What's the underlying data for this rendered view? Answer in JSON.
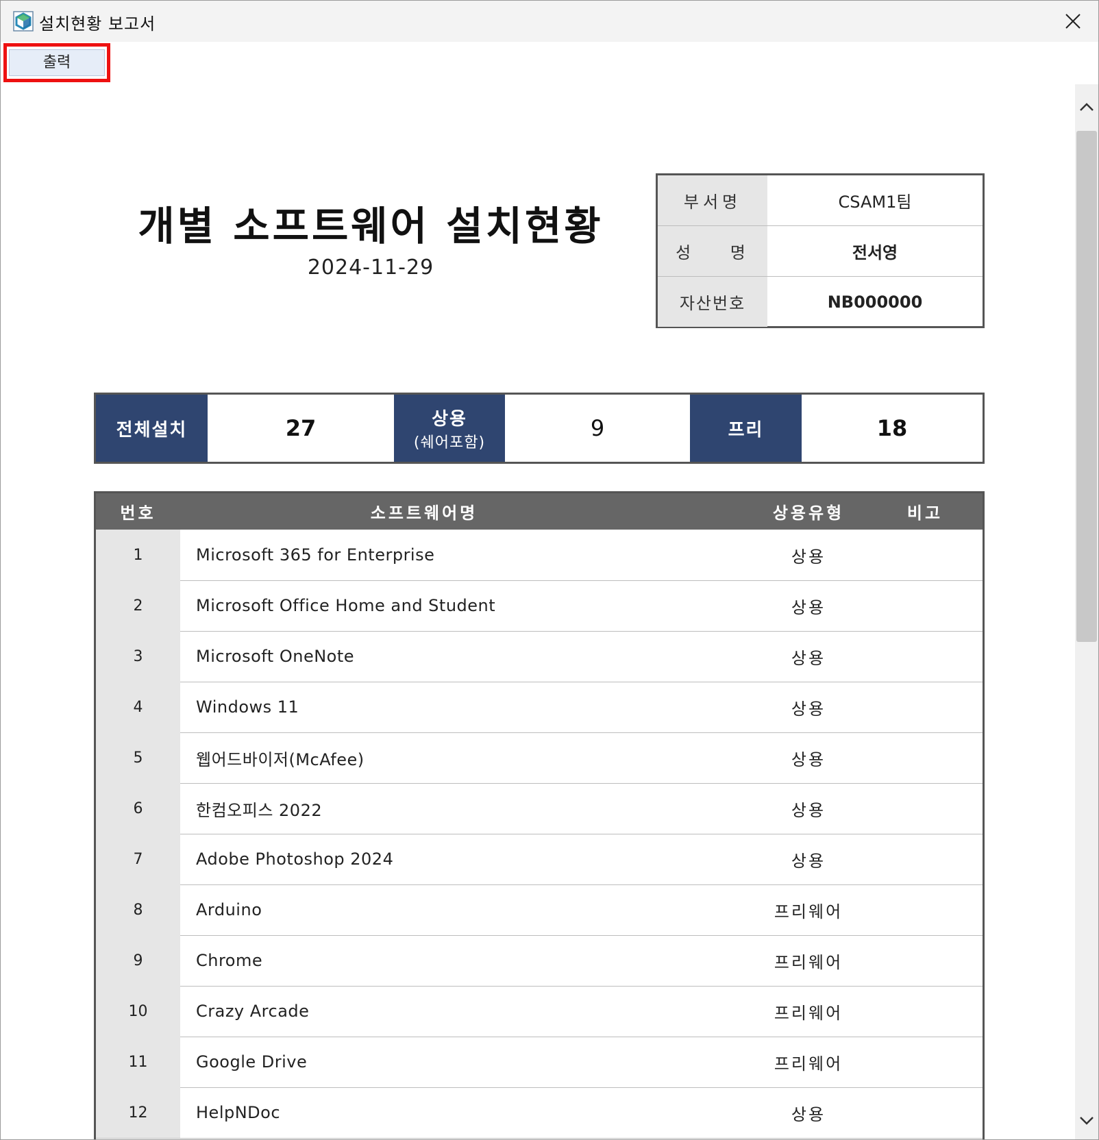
{
  "window": {
    "title": "설치현황 보고서",
    "app_icon": "app-logo-icon",
    "close_icon": "close-icon"
  },
  "toolbar": {
    "print_label": "출력"
  },
  "report": {
    "title": "개별 소프트웨어 설치현황",
    "date": "2024-11-29",
    "info": [
      {
        "label": "부서명",
        "value": "CSAM1팀"
      },
      {
        "label": "성 명",
        "value": "전서영"
      },
      {
        "label": "자산번호",
        "value": "NB000000"
      }
    ]
  },
  "summary": {
    "total_label": "전체설치",
    "total_value": "27",
    "commercial_label": "상용",
    "commercial_sublabel": "(쉐어포함)",
    "commercial_value": "9",
    "free_label": "프리",
    "free_value": "18"
  },
  "table": {
    "headers": {
      "no": "번호",
      "name": "소프트웨어명",
      "type": "상용유형",
      "note": "비고"
    },
    "rows": [
      {
        "no": "1",
        "name": "Microsoft 365 for Enterprise",
        "type": "상용",
        "note": ""
      },
      {
        "no": "2",
        "name": "Microsoft Office Home and Student",
        "type": "상용",
        "note": ""
      },
      {
        "no": "3",
        "name": "Microsoft OneNote",
        "type": "상용",
        "note": ""
      },
      {
        "no": "4",
        "name": "Windows 11",
        "type": "상용",
        "note": ""
      },
      {
        "no": "5",
        "name": "웹어드바이저(McAfee)",
        "type": "상용",
        "note": ""
      },
      {
        "no": "6",
        "name": "한컴오피스 2022",
        "type": "상용",
        "note": ""
      },
      {
        "no": "7",
        "name": "Adobe Photoshop 2024",
        "type": "상용",
        "note": ""
      },
      {
        "no": "8",
        "name": "Arduino",
        "type": "프리웨어",
        "note": ""
      },
      {
        "no": "9",
        "name": "Chrome",
        "type": "프리웨어",
        "note": ""
      },
      {
        "no": "10",
        "name": "Crazy Arcade",
        "type": "프리웨어",
        "note": ""
      },
      {
        "no": "11",
        "name": "Google Drive",
        "type": "프리웨어",
        "note": ""
      },
      {
        "no": "12",
        "name": "HelpNDoc",
        "type": "상용",
        "note": ""
      }
    ]
  },
  "colors": {
    "summary_label_bg": "#2f4570",
    "table_header_bg": "#666666",
    "highlight_border": "#ee1111",
    "label_bg": "#e6e6e6"
  }
}
